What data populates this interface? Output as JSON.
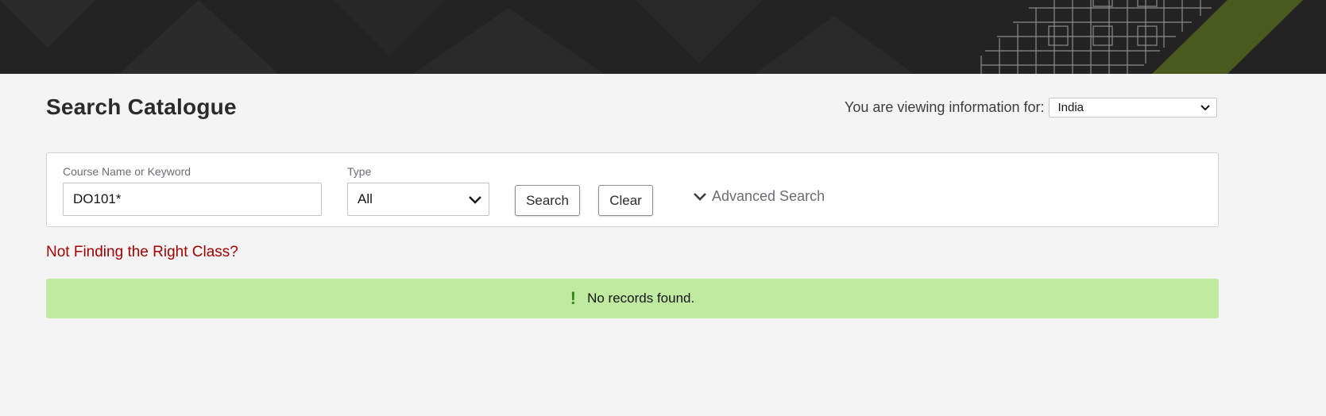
{
  "page": {
    "title": "Search Catalogue"
  },
  "locale": {
    "label": "You are viewing information for:",
    "selected": "India"
  },
  "search": {
    "keyword_label": "Course Name or Keyword",
    "keyword_value": "DO101*",
    "type_label": "Type",
    "type_value": "All",
    "search_button": "Search",
    "clear_button": "Clear",
    "advanced_label": "Advanced Search"
  },
  "help_link": "Not Finding the Right Class?",
  "alert": {
    "icon": "!",
    "message": "No records found."
  },
  "colors": {
    "banner": "#232323",
    "accent_green": "#4a5a1f",
    "link_red": "#a30000",
    "alert_bg": "#c0eaa0"
  }
}
